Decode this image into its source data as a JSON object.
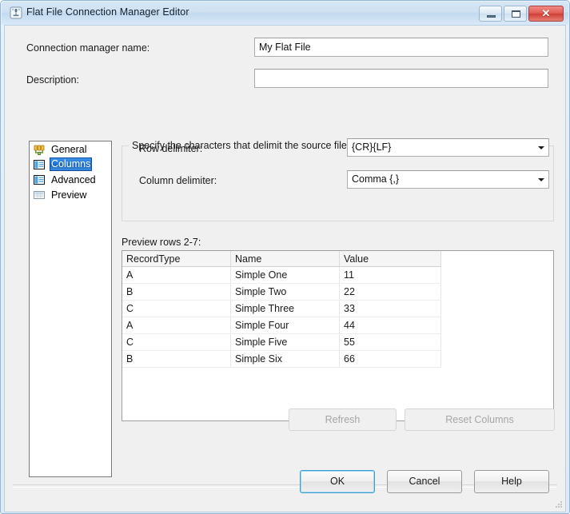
{
  "window": {
    "title": "Flat File Connection Manager Editor",
    "icon": "connection-manager-icon",
    "controls": {
      "minimize": "minimize-button",
      "maximize": "maximize-button",
      "close": "close-button",
      "close_glyph": "✕"
    }
  },
  "form": {
    "connection_name_label": "Connection manager name:",
    "connection_name_value": "My Flat File",
    "connection_name_placeholder": "",
    "description_label": "Description:",
    "description_value": "",
    "description_placeholder": ""
  },
  "sidebar": {
    "items": [
      {
        "label": "General",
        "icon": "general-page-icon",
        "selected": false
      },
      {
        "label": "Columns",
        "icon": "columns-page-icon",
        "selected": true
      },
      {
        "label": "Advanced",
        "icon": "advanced-page-icon",
        "selected": false
      },
      {
        "label": "Preview",
        "icon": "preview-page-icon",
        "selected": false
      }
    ]
  },
  "delimiters": {
    "legend": "Specify the characters that delimit the source file:",
    "row_delimiter_label": "Row delimiter:",
    "row_delimiter_value": "{CR}{LF}",
    "column_delimiter_label": "Column delimiter:",
    "column_delimiter_value": "Comma {,}"
  },
  "preview": {
    "label": "Preview rows 2-7:",
    "columns": [
      "RecordType",
      "Name",
      "Value"
    ],
    "rows": [
      [
        "A",
        "Simple One",
        "11"
      ],
      [
        "B",
        "Simple Two",
        "22"
      ],
      [
        "C",
        "Simple Three",
        "33"
      ],
      [
        "A",
        "Simple Four",
        "44"
      ],
      [
        "C",
        "Simple Five",
        "55"
      ],
      [
        "B",
        "Simple Six",
        "66"
      ]
    ]
  },
  "actions": {
    "refresh": "Refresh",
    "refresh_enabled": false,
    "reset_columns": "Reset Columns",
    "reset_columns_enabled": false
  },
  "dialog_buttons": {
    "ok": "OK",
    "cancel": "Cancel",
    "help": "Help"
  },
  "colors": {
    "selection_blue": "#1f6fd0",
    "default_button_outline": "#3c9fd4",
    "close_red": "#cf3e34",
    "titlebar": "#cfe1f2",
    "dialog_face": "#f0f0f0"
  }
}
